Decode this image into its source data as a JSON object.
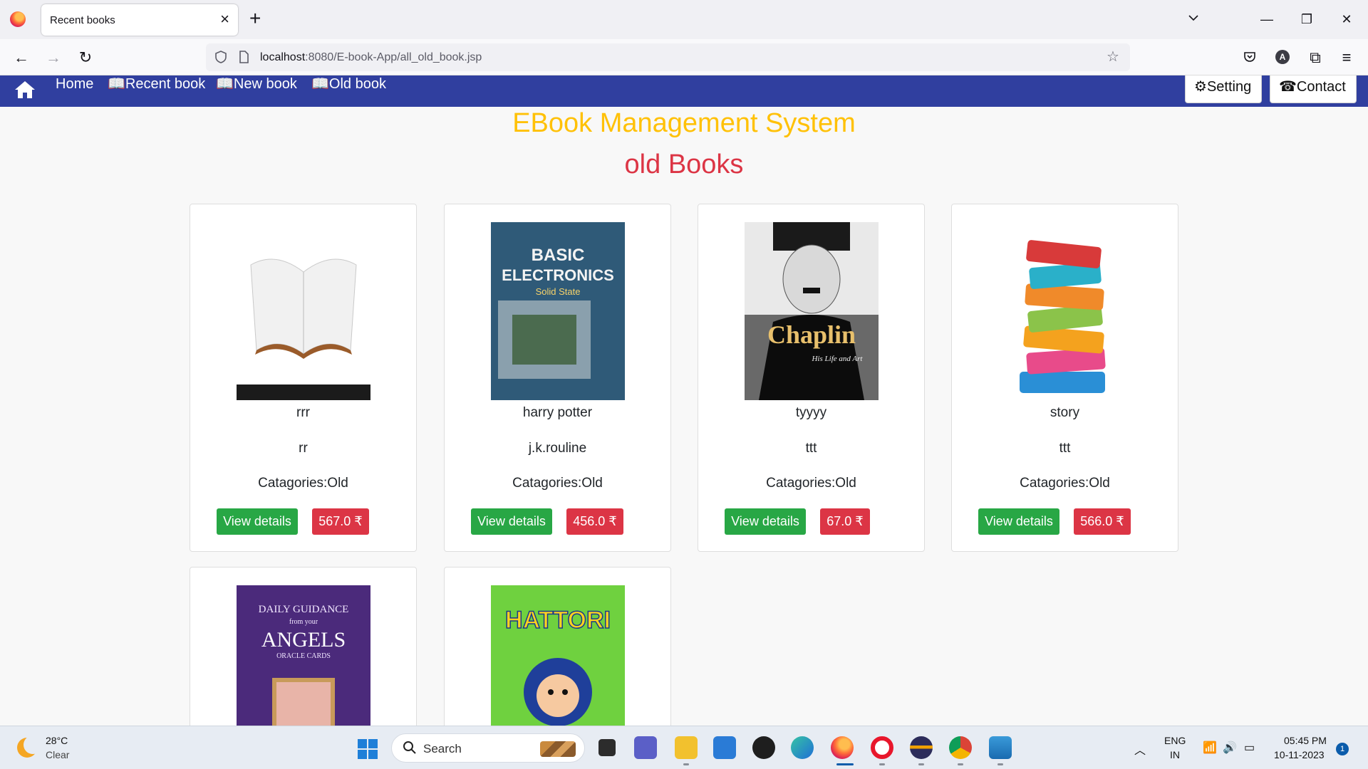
{
  "browser": {
    "tab_title": "Recent books",
    "url_host": "localhost",
    "url_rest": ":8080/E-book-App/all_old_book.jsp",
    "profile_initial": "A"
  },
  "site_nav": {
    "links": [
      {
        "label": "Home"
      },
      {
        "label": "Recent book"
      },
      {
        "label": "New book"
      },
      {
        "label": "Old book"
      }
    ],
    "setting_label": "Setting",
    "contact_label": "Contact",
    "bar_color": "#303f9f"
  },
  "page": {
    "title": "EBook Management System",
    "subtitle": "old Books"
  },
  "books": [
    {
      "name": "rrr",
      "author": "rr",
      "category": "Catagories:Old",
      "view_label": "View details",
      "price": "567.0 ₹",
      "cover_icon": "open-book-cover"
    },
    {
      "name": "harry potter",
      "author": "j.k.rouline",
      "category": "Catagories:Old",
      "view_label": "View details",
      "price": "456.0 ₹",
      "cover_icon": "basic-electronics-cover",
      "cover_text": {
        "line1": "BASIC",
        "line2": "ELECTRONICS",
        "line3": "Solid State"
      }
    },
    {
      "name": "tyyyy",
      "author": "ttt",
      "category": "Catagories:Old",
      "view_label": "View details",
      "price": "67.0 ₹",
      "cover_icon": "chaplin-cover",
      "cover_text": {
        "line1": "Chaplin",
        "line2": "His Life and Art"
      }
    },
    {
      "name": "story",
      "author": "ttt",
      "category": "Catagories:Old",
      "view_label": "View details",
      "price": "566.0 ₹",
      "cover_icon": "book-stack-cover"
    },
    {
      "cover_icon": "angels-cover",
      "cover_text": {
        "line1": "DAILY GUIDANCE",
        "line2": "from your",
        "line3": "ANGELS",
        "line4": "ORACLE CARDS"
      }
    },
    {
      "cover_icon": "hattori-cover",
      "cover_text": {
        "line1": "HATTORI"
      }
    }
  ],
  "taskbar": {
    "temperature": "28°C",
    "condition": "Clear",
    "search_label": "Search",
    "lang_line1": "ENG",
    "lang_line2": "IN",
    "time": "05:45 PM",
    "date": "10-11-2023",
    "notification_count": "1"
  }
}
